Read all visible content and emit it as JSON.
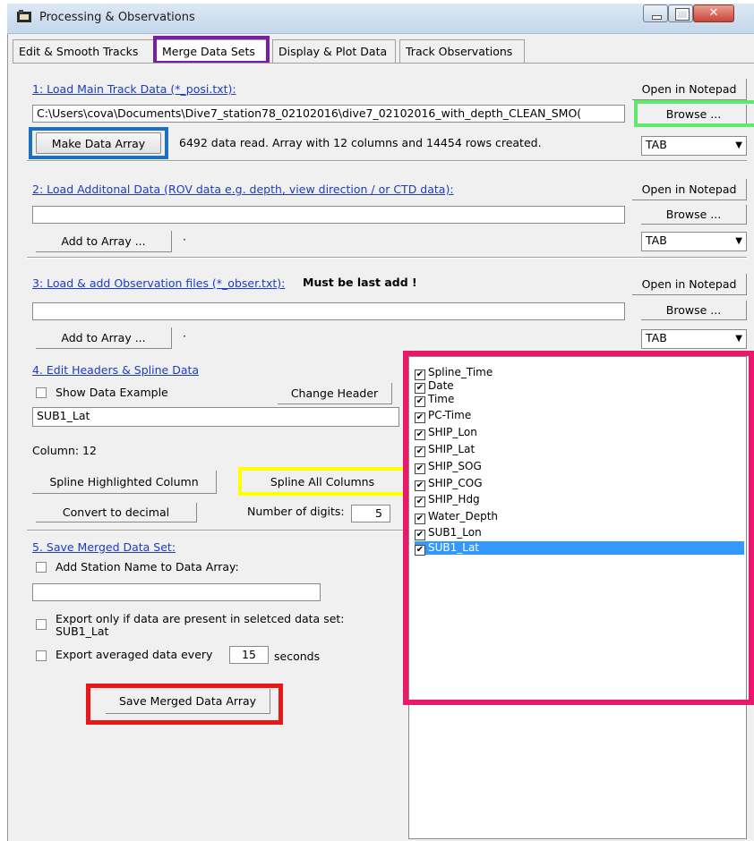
{
  "window": {
    "title": "Processing & Observations"
  },
  "tabs": [
    "Edit & Smooth Tracks",
    "Merge Data Sets",
    "Display & Plot Data",
    "Track Observations"
  ],
  "section1": {
    "link": "1: Load Main Track Data (*_posi.txt):",
    "notepad_label": "Open in Notepad",
    "path_value": "C:\\Users\\cova\\Documents\\Dive7_station78_02102016\\dive7_02102016_with_depth_CLEAN_SMO(",
    "browse_label": "Browse ...",
    "make_array_label": "Make Data Array",
    "status": "6492 data read.   Array with 12 columns and 14454 rows created.",
    "delimiter": "TAB"
  },
  "section2": {
    "link": "2: Load Additonal Data (ROV data e.g. depth, view direction / or CTD data):",
    "notepad_label": "Open in Notepad",
    "path_value": "",
    "browse_label": "Browse ...",
    "add_label": "Add to Array ...",
    "dot": "·",
    "delimiter": "TAB"
  },
  "section3": {
    "link": "3: Load & add Observation files (*_obser.txt):",
    "warning": "Must be last add !",
    "notepad_label": "Open in Notepad",
    "path_value": "",
    "browse_label": "Browse ...",
    "add_label": "Add to Array ...",
    "dot": "·",
    "delimiter": "TAB"
  },
  "section4": {
    "link": "4. Edit Headers & Spline Data",
    "show_example_label": "Show Data Example",
    "change_header_label": "Change Header",
    "header_value": "SUB1_Lat",
    "column_text": "Column: 12",
    "spline_highlighted_label": "Spline Highlighted Column",
    "spline_all_label": "Spline All Columns",
    "convert_label": "Convert to decimal",
    "digits_label": "Number of digits:",
    "digits_value": "5"
  },
  "section5": {
    "link": "5. Save Merged Data Set:",
    "add_station_label": "Add Station Name to Data Array:",
    "station_value": "",
    "export_present_label": "Export only if data are present in seletced data set:",
    "export_present_set": "SUB1_Lat",
    "export_avg_label": "Export averaged data every",
    "export_avg_value": "15",
    "export_avg_unit": "seconds",
    "save_label": "Save Merged Data Array"
  },
  "columns": [
    "Spline_Time",
    "Date",
    "Time",
    "PC-Time",
    "SHIP_Lon",
    "SHIP_Lat",
    "SHIP_SOG",
    "SHIP_COG",
    "SHIP_Hdg",
    "Water_Depth",
    "SUB1_Lon",
    "SUB1_Lat"
  ],
  "selected_column": "SUB1_Lat",
  "check_glyph": "✔",
  "colors": {
    "highlight_purple": "#7a1fa2",
    "highlight_green": "#5fe86a",
    "highlight_blue": "#1f6fbf",
    "highlight_yellow": "#ffff00",
    "highlight_pink": "#e8186a",
    "highlight_red": "#e81818",
    "selection": "#3399ff",
    "link": "#1a3cc8"
  }
}
